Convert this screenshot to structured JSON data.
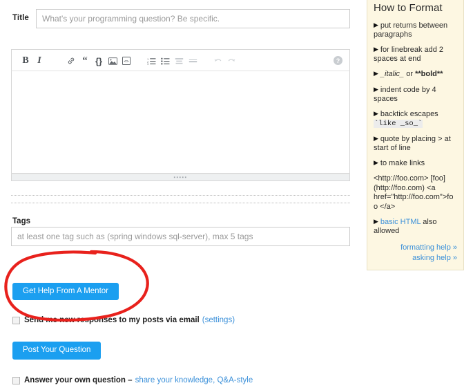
{
  "form": {
    "title_label": "Title",
    "title_value": "",
    "title_placeholder": "What's your programming question? Be specific.",
    "body_value": "",
    "tags_label": "Tags",
    "tags_value": "",
    "tags_placeholder": "at least one tag such as (spring windows sql-server), max 5 tags"
  },
  "toolbar": {
    "bold": "B",
    "italic": "I",
    "link": "ℒ",
    "quote": "“",
    "code": "{}",
    "image": "▣",
    "html": "▧",
    "ordered_list": "≡",
    "bullet_list": "•≡",
    "heading": "≡",
    "rule": "—",
    "undo": "↩",
    "redo": "↪",
    "help": "?"
  },
  "buttons": {
    "mentor": "Get Help From A Mentor",
    "post": "Post Your Question"
  },
  "options": {
    "email_text": "Send me new responses to my posts via email",
    "email_link": "(settings)",
    "answer_text": "Answer your own question –",
    "answer_link": "share your knowledge, Q&A-style"
  },
  "sidebar": {
    "title": "How to Format",
    "items": [
      {
        "text": "put returns between paragraphs"
      },
      {
        "text": "for linebreak add 2 spaces at end"
      },
      {
        "text": "_italic_ or **bold**"
      },
      {
        "text": "indent code by 4 spaces"
      },
      {
        "text": "backtick escapes",
        "code": "`like _so_`"
      },
      {
        "text": "quote by placing > at start of line"
      },
      {
        "text": "to make links"
      }
    ],
    "link_examples": "<http://foo.com> [foo](http://foo.com) <a href=\"http://foo.com\">foo </a>",
    "html_item_link": "basic HTML",
    "html_item_rest": "also allowed",
    "help_links": [
      "formatting help »",
      "asking help »"
    ]
  },
  "annotation": {
    "shape": "hand-drawn-red-ellipse",
    "color": "#e8211c",
    "targets": "Get Help From A Mentor"
  },
  "colors": {
    "accent_blue": "#1b9ff0",
    "link_blue": "#3b90d9",
    "sidebar_bg": "#fdf7e2",
    "annotation_red": "#e8211c"
  }
}
